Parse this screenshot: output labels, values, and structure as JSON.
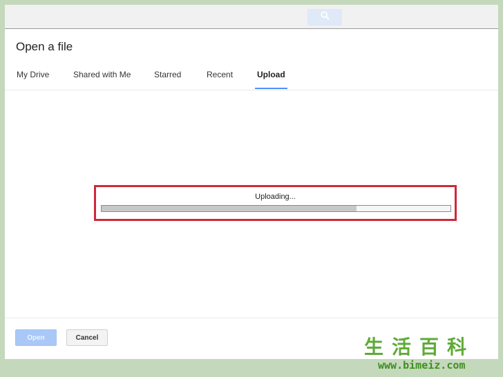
{
  "dialog": {
    "title": "Open a file"
  },
  "tabs": [
    {
      "label": "My Drive",
      "active": false
    },
    {
      "label": "Shared with Me",
      "active": false
    },
    {
      "label": "Starred",
      "active": false
    },
    {
      "label": "Recent",
      "active": false
    },
    {
      "label": "Upload",
      "active": true
    }
  ],
  "upload": {
    "status_text": "Uploading...",
    "progress_percent": 73
  },
  "footer": {
    "open_label": "Open",
    "cancel_label": "Cancel"
  },
  "icons": {
    "search": "search-icon"
  },
  "colors": {
    "accent": "#4d90fe",
    "highlight_border": "#d0283a",
    "open_button_disabled": "#a9c8f7"
  },
  "watermark": {
    "chinese": "生活百科",
    "url": "www.bimeiz.com"
  }
}
